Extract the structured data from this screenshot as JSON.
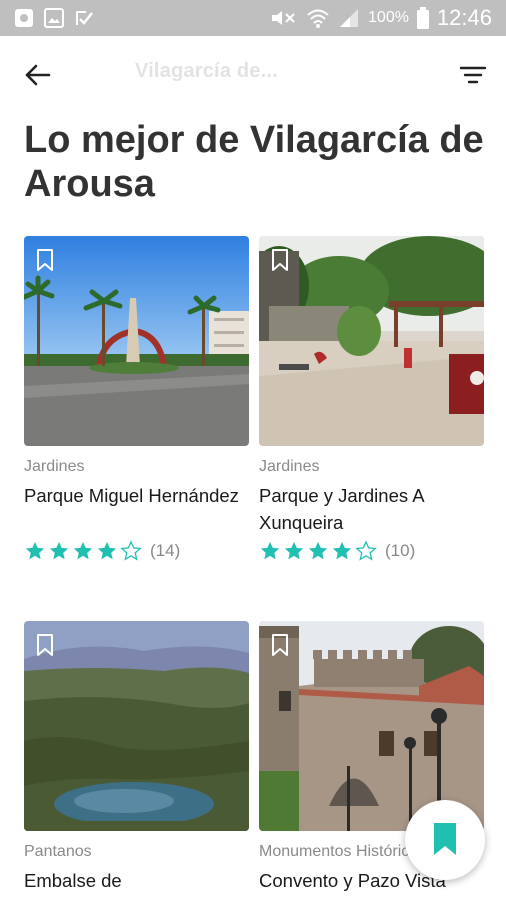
{
  "status_bar": {
    "battery_percent": "100%",
    "time": "12:46"
  },
  "app_bar": {
    "title": "Vilagarcía de..."
  },
  "page": {
    "title": "Lo mejor de Vilagarcía de Arousa"
  },
  "accent": "#1fbfb2",
  "places": [
    {
      "category": "Jardines",
      "name": "Parque Miguel Hernández",
      "rating": 4,
      "reviews": "(14)"
    },
    {
      "category": "Jardines",
      "name": "Parque y Jardines A Xunqueira",
      "rating": 4,
      "reviews": "(10)"
    },
    {
      "category": "Pantanos",
      "name": "Embalse de"
    },
    {
      "category": "Monumentos Históricos",
      "name": "Convento y Pazo Vista"
    }
  ],
  "icons": [
    "back-arrow-icon",
    "filter-icon",
    "bookmark-outline-icon",
    "bookmark-filled-icon",
    "star-icon"
  ]
}
